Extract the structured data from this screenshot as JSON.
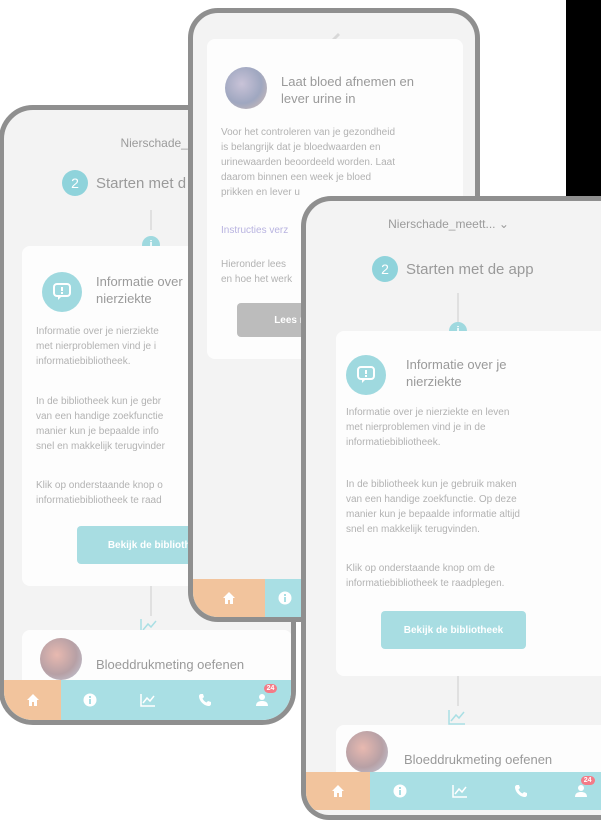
{
  "phone_left": {
    "header_title": "Nierschade_meet",
    "step_number": "2",
    "step_label": "Starten met d",
    "card_title": "Informatie over\nnierziekte",
    "para1": "Informatie over je nierziekte\nmet nierproblemen vind je i\ninformatiebibliotheek.",
    "para2": "In de bibliotheek kun je gebr\nvan een handige zoekfunctie\nmanier kun je bepaalde info\nsnel en makkelijk terugvinder",
    "para3": "Klik op onderstaande knop o\ninformatiebibliotheek te raad",
    "button_label": "Bekijk de bibliothe",
    "next_title": "Bloeddrukmeting oefenen",
    "badge": "24"
  },
  "phone_middle": {
    "card_title": "Laat bloed afnemen en\nlever urine in",
    "para1": "Voor het controleren van je gezondheid\nis belangrijk dat je bloedwaarden en\nurinewaarden beoordeeld worden. Laat\ndaarom binnen een week je bloed\nprikken en lever u",
    "link": "Instructies verz",
    "para2": "Hieronder lees\nen hoe het werk",
    "button_label": "Lees mee"
  },
  "phone_right": {
    "header_title": "Nierschade_meett... ⌄",
    "step_number": "2",
    "step_label": "Starten met de app",
    "card_title": "Informatie over je\nnierziekte",
    "para1": "Informatie over je nierziekte en leven\nmet nierproblemen vind je in de\ninformatiebibliotheek.",
    "para2": "In de bibliotheek kun je gebruik maken\nvan een handige zoekfunctie. Op deze\nmanier kun je bepaalde informatie altijd\nsnel en makkelijk terugvinden.",
    "para3": "Klik op onderstaande knop om de\ninformatiebibliotheek te raadplegen.",
    "button_label": "Bekijk de bibliotheek",
    "next_title": "Bloeddrukmeting oefenen",
    "badge": "24"
  },
  "nav_icons": [
    "home-icon",
    "info-icon",
    "chart-icon",
    "phone-icon",
    "profile-icon"
  ],
  "colors": {
    "teal": "#a9dfe4",
    "home_orange": "#f2c49d",
    "badge_red": "#f47b87",
    "frame": "#8f8f8f"
  }
}
